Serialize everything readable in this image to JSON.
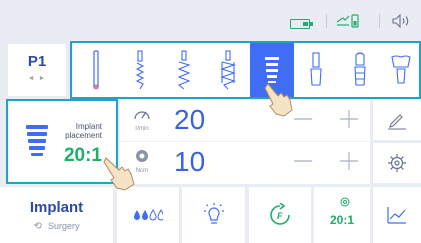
{
  "status": {
    "battery_icon": "battery-icon",
    "signal_icon": "signal-icon",
    "sound_icon": "speaker-icon"
  },
  "program": {
    "label": "P1",
    "arrows": "◄ ►"
  },
  "tools": {
    "items": [
      "drill-1",
      "drill-2",
      "drill-3",
      "drill-4",
      "implant",
      "abutment-1",
      "abutment-2",
      "crown"
    ],
    "active_index": 4
  },
  "mode": {
    "title_line1": "Implant",
    "title_line2": "placement",
    "ratio": "20:1"
  },
  "params": {
    "speed": {
      "unit": "r/min",
      "value": "20"
    },
    "torque": {
      "unit": "Ncm",
      "value": "10"
    }
  },
  "bottom": {
    "implant_name": "Implant",
    "implant_sub": "Surgery",
    "ratio": "20:1"
  },
  "colors": {
    "accent": "#3f6df5",
    "border": "#20a3c7",
    "green": "#1fae6b",
    "navy": "#2d4aa8"
  }
}
